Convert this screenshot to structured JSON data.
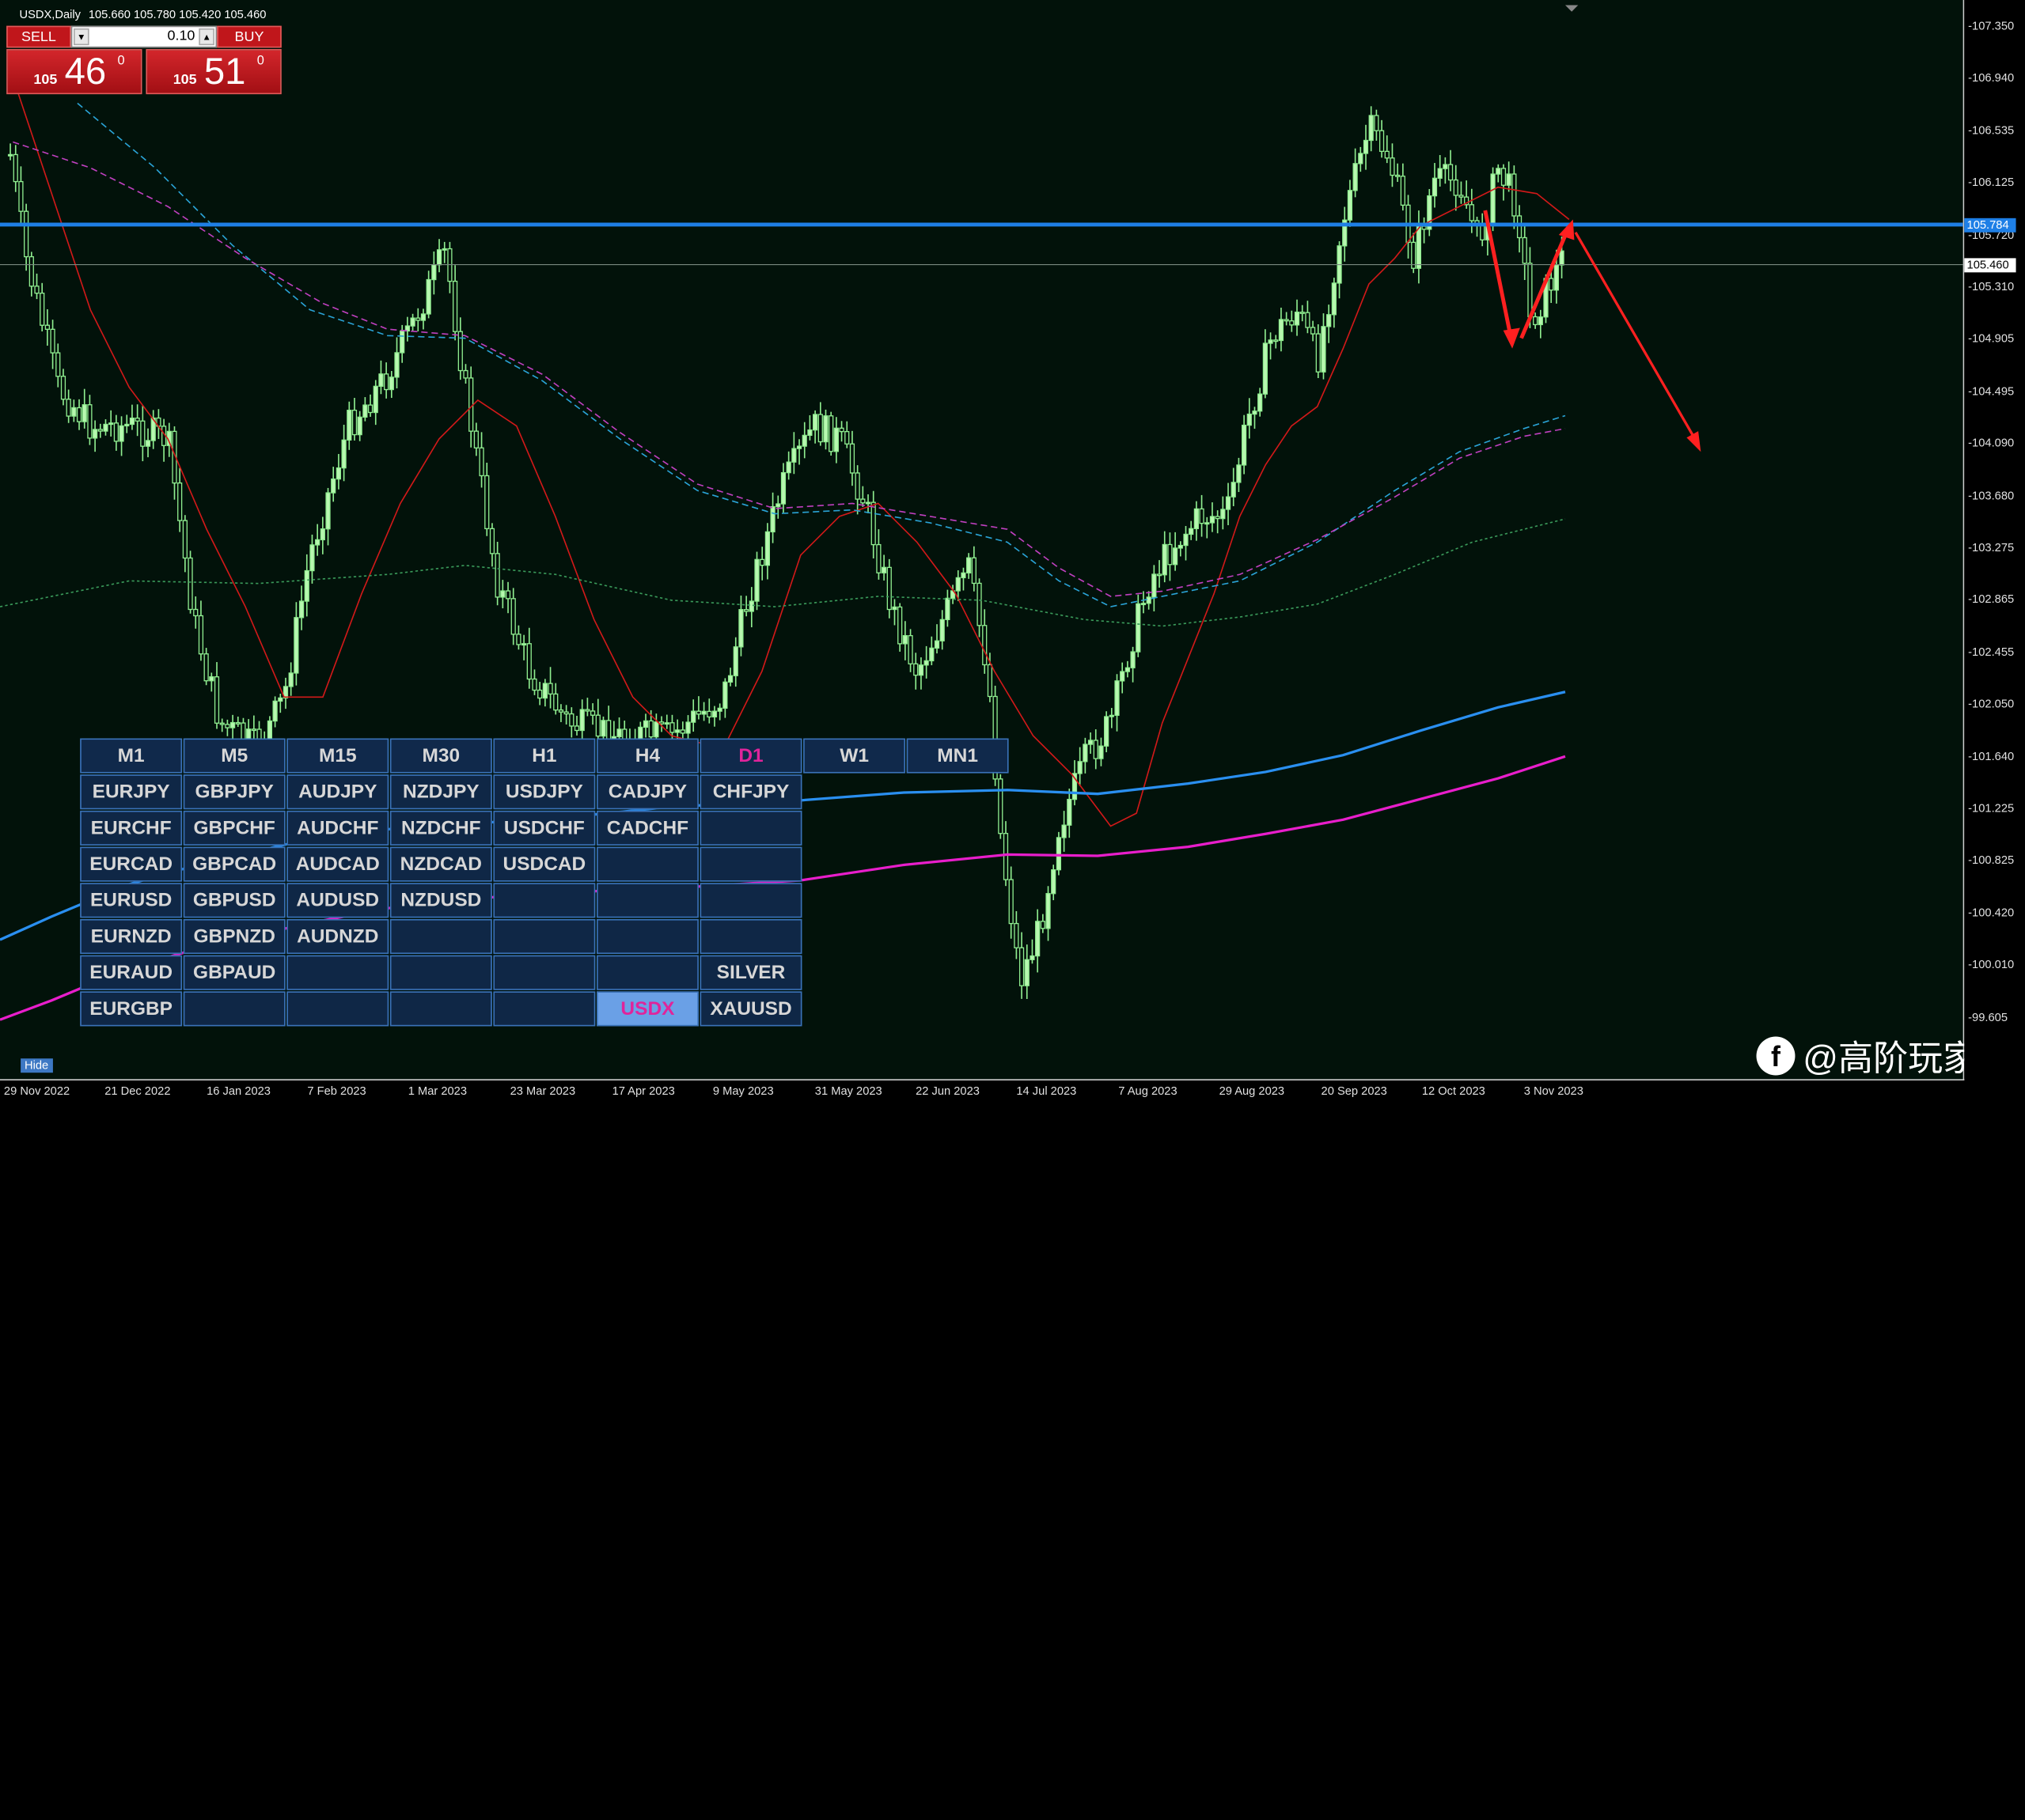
{
  "header": {
    "symbol_tf": "USDX,Daily",
    "ohlc": "105.660 105.780 105.420 105.460"
  },
  "trade_panel": {
    "sell_label": "SELL",
    "buy_label": "BUY",
    "lot": "0.10",
    "sell_price_small": "105",
    "sell_price_big": "46",
    "sell_price_sup": "0",
    "buy_price_small": "105",
    "buy_price_big": "51",
    "buy_price_sup": "0"
  },
  "timeframes": [
    "M1",
    "M5",
    "M15",
    "M30",
    "H1",
    "H4",
    "D1",
    "W1",
    "MN1"
  ],
  "active_timeframe": "D1",
  "symbol_rows": [
    [
      "EURJPY",
      "GBPJPY",
      "AUDJPY",
      "NZDJPY",
      "USDJPY",
      "CADJPY",
      "CHFJPY"
    ],
    [
      "EURCHF",
      "GBPCHF",
      "AUDCHF",
      "NZDCHF",
      "USDCHF",
      "CADCHF",
      ""
    ],
    [
      "EURCAD",
      "GBPCAD",
      "AUDCAD",
      "NZDCAD",
      "USDCAD",
      "",
      ""
    ],
    [
      "EURUSD",
      "GBPUSD",
      "AUDUSD",
      "NZDUSD",
      "",
      "",
      ""
    ],
    [
      "EURNZD",
      "GBPNZD",
      "AUDNZD",
      "",
      "",
      "",
      ""
    ],
    [
      "EURAUD",
      "GBPAUD",
      "",
      "",
      "",
      "",
      "SILVER"
    ],
    [
      "EURGBP",
      "",
      "",
      "",
      "",
      "USDX",
      "XAUUSD"
    ]
  ],
  "selected_symbol": "USDX",
  "price_labels": [
    "107.350",
    "106.940",
    "106.535",
    "106.125",
    "105.720",
    "105.310",
    "104.905",
    "104.495",
    "104.090",
    "103.680",
    "103.275",
    "102.865",
    "102.455",
    "102.050",
    "101.640",
    "101.225",
    "100.825",
    "100.420",
    "100.010",
    "99.605"
  ],
  "price_tags": {
    "hline": "105.784",
    "bid": "105.460"
  },
  "time_labels": [
    "29 Nov 2022",
    "21 Dec 2022",
    "16 Jan 2023",
    "7 Feb 2023",
    "1 Mar 2023",
    "23 Mar 2023",
    "17 Apr 2023",
    "9 May 2023",
    "31 May 2023",
    "22 Jun 2023",
    "14 Jul 2023",
    "7 Aug 2023",
    "29 Aug 2023",
    "20 Sep 2023",
    "12 Oct 2023",
    "3 Nov 2023"
  ],
  "hide_button": "Hide",
  "watermark": {
    "logo": "f",
    "text": "@高阶玩家"
  },
  "colors": {
    "background": "#02120a",
    "candles": "#90ee90",
    "hline": "#1e7fe6",
    "arrows": "#ff2020",
    "ma_fast": "#d11919",
    "ma_blue_solid": "#2a8ff0",
    "ma_magenta_solid": "#e81ecb",
    "ma_cyan_dash": "#2aa3d6",
    "ma_magenta_dash": "#c040c0",
    "ma_green_dot": "#3a9a5a"
  }
}
